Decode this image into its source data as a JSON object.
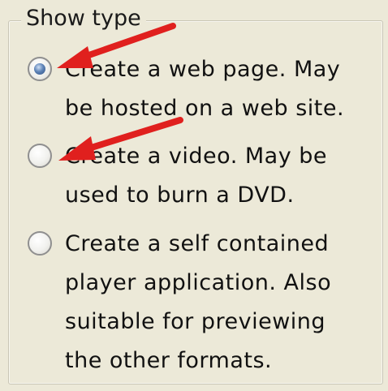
{
  "groupbox": {
    "legend": "Show type"
  },
  "options": [
    {
      "label": "Create a web page. May be hosted on a web site.",
      "checked": true
    },
    {
      "label": "Create a video. May be used to burn a DVD.",
      "checked": false
    },
    {
      "label": "Create a self contained player application. Also suitable for previewing the other formats.",
      "checked": false
    }
  ],
  "colors": {
    "panel_bg": "#ece9d8",
    "annotation_arrow": "#e0201e"
  },
  "icons": {
    "annotation": "red-arrow-icon"
  }
}
